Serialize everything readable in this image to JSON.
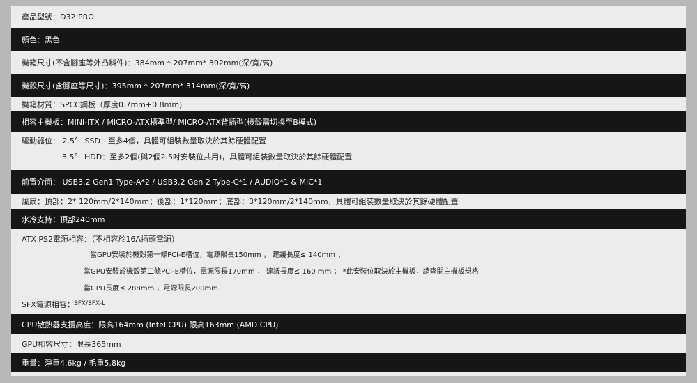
{
  "specs": {
    "model": "產品型號：D32 PRO",
    "color": "顏色：黑色",
    "case_size_excl": "機箱尺寸(不含腳座等外凸料件)：384mm * 207mm* 302mm(深/寬/高)",
    "case_size_incl": "機殼尺寸(含腳座等尺寸)：395mm * 207mm* 314mm(深/寬/高)",
    "material": "機箱材質：SPCC鋼板（厚度0.7mm+0.8mm)",
    "motherboard": "相容主機板：MINI-ITX / MICRO-ATX標準型/ MICRO-ATX背插型(機殼需切換至B模式)",
    "drive_bays_line1": "驅動器位： 2.5〞 SSD：至多4個，具體可組裝數量取決於其餘硬體配置",
    "drive_bays_line2": "3.5〞 HDD：至多2個(與2個2.5吋安裝位共用)，具體可組裝數量取決於其餘硬體配置",
    "front_io": "前置介面： USB3.2 Gen1 Type-A*2 / USB3.2 Gen 2 Type-C*1 / AUDIO*1 & MIC*1",
    "fans": "風扇：頂部：2* 120mm/2*140mm；後部：1*120mm；底部：3*120mm/2*140mm，具體可組裝數量取決於其餘硬體配置",
    "water_cooling": "水冷支持：頂部240mm",
    "atx_psu": "ATX PS2電源相容：（不相容於16A插頭電源）",
    "atx_psu_line1": "當GPU安裝於機殼第一條PCI-E槽位，電源限長150mm ， 建議長度≤ 140mm ；",
    "atx_psu_line2": "當GPU安裝於機殼第二條PCI-E槽位，電源限長170mm ， 建議長度≤ 160 mm ； *此安裝位取決於主機板，請查閱主機板規格",
    "atx_psu_line3": "當GPU長度≤ 288mm ，電源限長200mm",
    "sfx_psu_label": "SFX電源相容：",
    "sfx_psu_value": "SFX/SFX-L",
    "cpu_cooler": "CPU散熱器支援高度：限高164mm (Intel CPU) 限高163mm (AMD CPU)",
    "gpu": "GPU相容尺寸：限長365mm",
    "weight": "重量：淨重4.6kg / 毛重5.8kg"
  }
}
